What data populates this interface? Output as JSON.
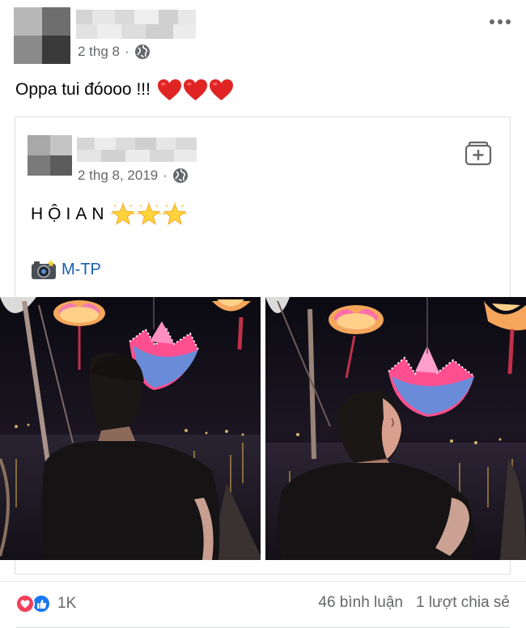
{
  "post": {
    "timestamp": "2 thg 8",
    "privacy_icon": "globe-icon",
    "text": "Oppa tui đóooo !!!",
    "hearts_icon": "red-heart-icon"
  },
  "shared_post": {
    "timestamp": "2 thg 8, 2019",
    "privacy_icon": "globe-icon",
    "caption": "HỘIAN",
    "caption_icon": "glowing-star-icon",
    "credit_icon": "camera-flash-icon",
    "credit": "M-TP",
    "save_icon": "save-collection-icon"
  },
  "photos": [
    {
      "name": "hoi-an-lantern-photo-1"
    },
    {
      "name": "hoi-an-lantern-photo-2"
    }
  ],
  "footer": {
    "reaction_count": "1K",
    "comments": "46 bình luận",
    "shares": "1 lượt chia sẻ"
  },
  "colors": {
    "text": "#050505",
    "secondary": "#65676b",
    "link": "#1a5fb4",
    "love": "#f33e58",
    "like": "#1877f2"
  }
}
